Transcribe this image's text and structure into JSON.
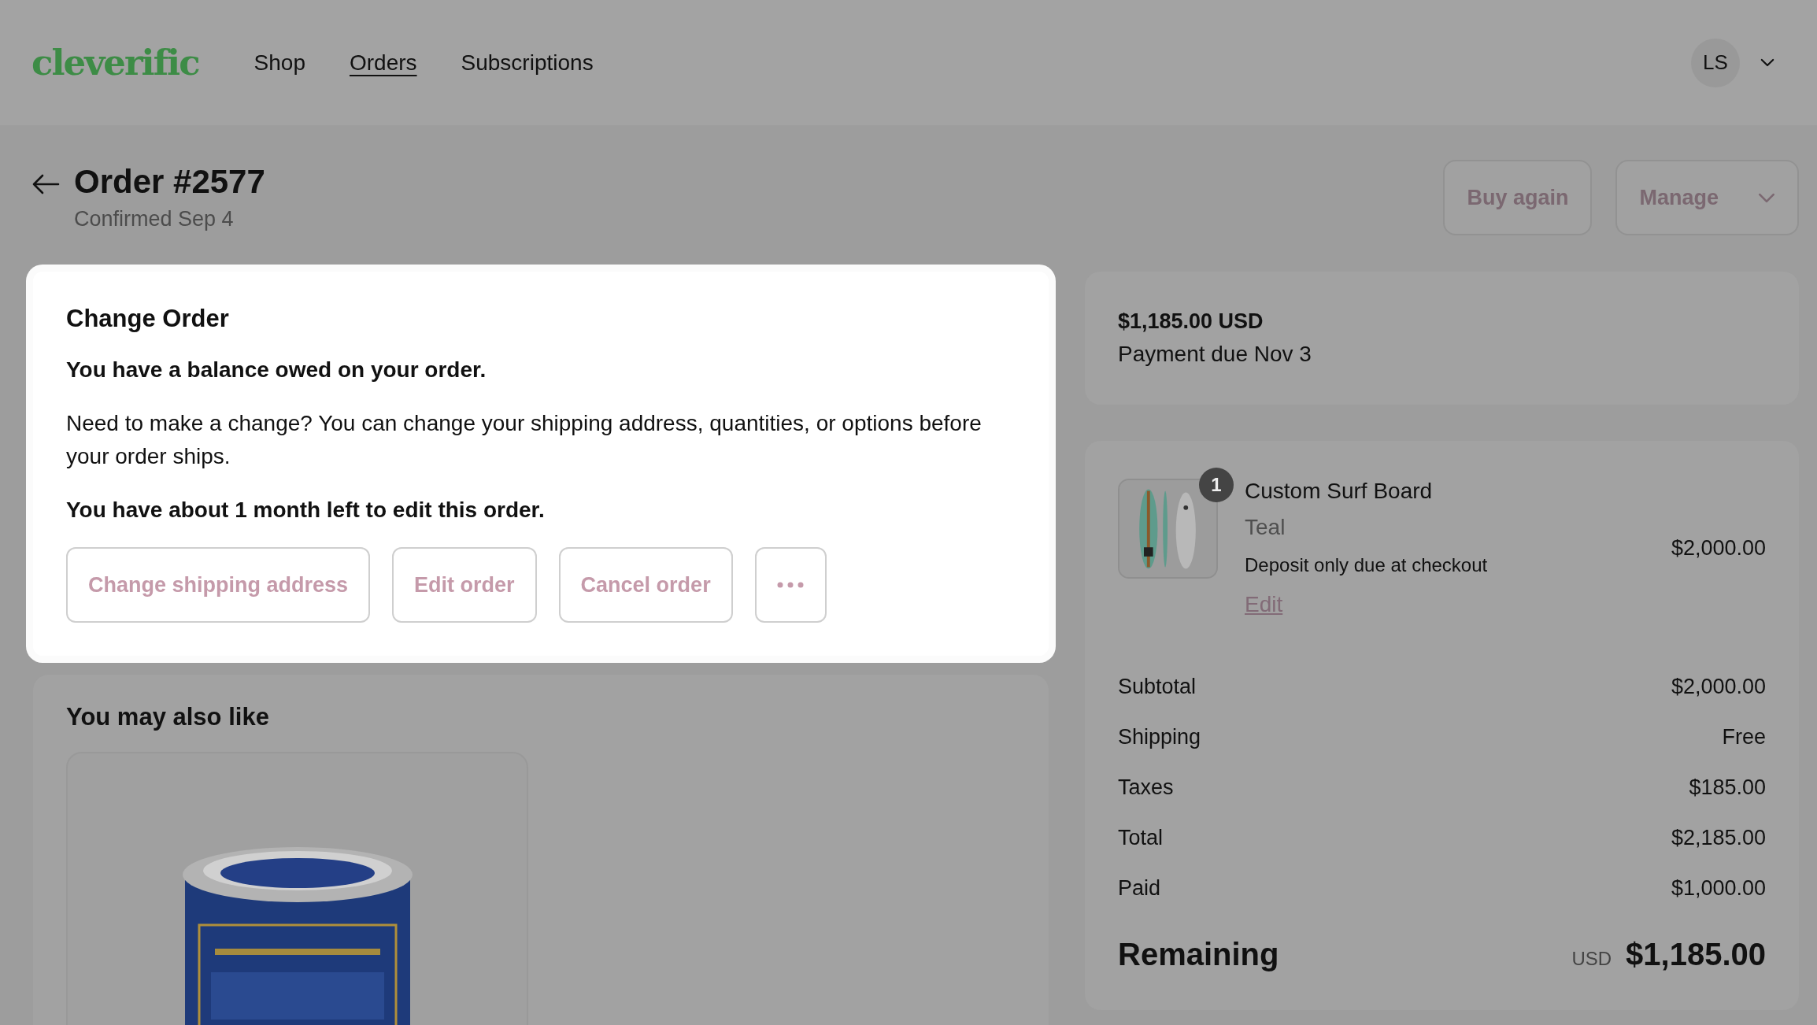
{
  "header": {
    "logo": "cleverific",
    "nav": [
      {
        "label": "Shop",
        "selected": false
      },
      {
        "label": "Orders",
        "selected": true
      },
      {
        "label": "Subscriptions",
        "selected": false
      }
    ],
    "account": {
      "initials": "LS"
    }
  },
  "order": {
    "title": "Order #2577",
    "subtitle": "Confirmed Sep 4",
    "actions": [
      {
        "label": "Buy again",
        "kind": "plain"
      },
      {
        "label": "Manage",
        "kind": "dropdown"
      }
    ]
  },
  "change_order": {
    "highlighted": true,
    "title": "Change Order",
    "balance_notice": "You have a balance owed on your order.",
    "description": "Need to make a change? You can change your shipping address, quantities, or options before your order ships.",
    "time_left": "You have about 1 month left to edit this order.",
    "buttons": [
      {
        "kind": "text",
        "label": "Change shipping address"
      },
      {
        "kind": "text",
        "label": "Edit order"
      },
      {
        "kind": "text",
        "label": "Cancel order"
      },
      {
        "kind": "more"
      }
    ]
  },
  "recommendations": {
    "title": "You may also like"
  },
  "payment": {
    "amount": "$1,185.00 USD",
    "due": "Payment due Nov 3"
  },
  "line_items": [
    {
      "name": "Custom Surf Board",
      "variant": "Teal",
      "note": "Deposit only due at checkout",
      "edit_link": "Edit",
      "price": "$2,000.00",
      "quantity": "1"
    }
  ],
  "summary": [
    {
      "label": "Subtotal",
      "value": "$2,000.00"
    },
    {
      "label": "Shipping",
      "value": "Free"
    },
    {
      "label": "Taxes",
      "value": "$185.00"
    },
    {
      "label": "Total",
      "value": "$2,185.00"
    },
    {
      "label": "Paid",
      "value": "$1,000.00"
    }
  ],
  "remaining": {
    "label": "Remaining",
    "currency": "USD",
    "amount": "$1,185.00"
  }
}
